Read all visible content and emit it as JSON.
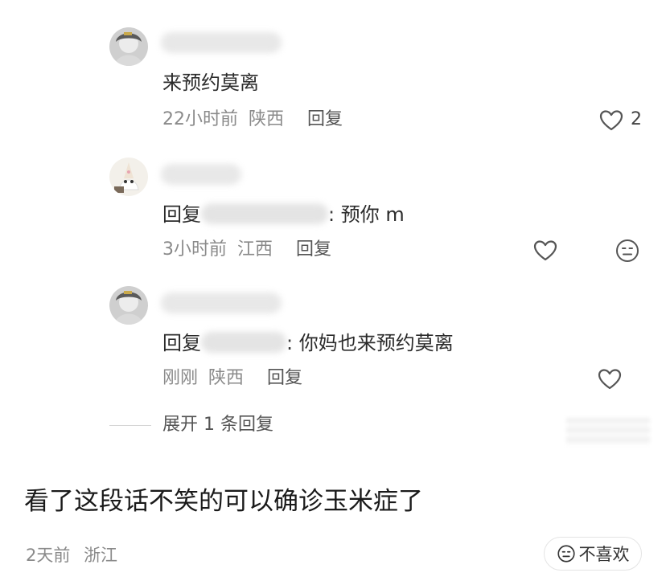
{
  "comments": [
    {
      "text": "来预约莫离",
      "time": "22小时前",
      "location": "陕西",
      "reply_label": "回复",
      "likes": "2"
    },
    {
      "prefix": "回复",
      "suffix": ": 预你 m",
      "time": "3小时前",
      "location": "江西",
      "reply_label": "回复"
    },
    {
      "prefix": "回复",
      "suffix": ": 你妈也来预约莫离",
      "time": "刚刚",
      "location": "陕西",
      "reply_label": "回复"
    }
  ],
  "expand_label": "展开 1 条回复",
  "post": {
    "caption": "看了这段话不笑的可以确诊玉米症了",
    "time": "2天前",
    "location": "浙江",
    "dislike_label": "不喜欢"
  },
  "icons": {
    "like": "heart-outline-icon",
    "emoji": "neutral-face-icon"
  },
  "colors": {
    "text_primary": "#2b2b2b",
    "text_meta": "#8a8a8a"
  }
}
